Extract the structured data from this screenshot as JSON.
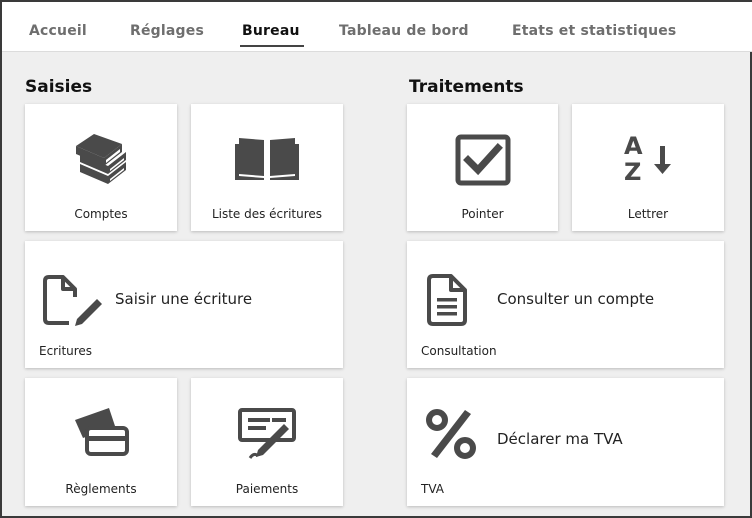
{
  "tabs": [
    {
      "label": "Accueil"
    },
    {
      "label": "Réglages"
    },
    {
      "label": "Bureau"
    },
    {
      "label": "Tableau de bord"
    },
    {
      "label": "Etats et statistiques"
    }
  ],
  "active_tab": "Bureau",
  "sections": {
    "saisies": {
      "title": "Saisies",
      "comptes": {
        "label": "Comptes",
        "icon": "books-icon"
      },
      "liste_ecritures": {
        "label": "Liste des écritures",
        "icon": "open-book-icon"
      },
      "ecritures": {
        "action": "Saisir une écriture",
        "label": "Ecritures",
        "icon": "document-edit-icon"
      },
      "reglements": {
        "label": "Règlements",
        "icon": "credit-cards-icon"
      },
      "paiements": {
        "label": "Paiements",
        "icon": "check-sign-icon"
      }
    },
    "traitements": {
      "title": "Traitements",
      "pointer": {
        "label": "Pointer",
        "icon": "checkbox-icon"
      },
      "lettrer": {
        "label": "Lettrer",
        "icon": "sort-az-icon"
      },
      "consultation": {
        "action": "Consulter un compte",
        "label": "Consultation",
        "icon": "document-lines-icon"
      },
      "tva": {
        "action": "Déclarer ma TVA",
        "label": "TVA",
        "icon": "percent-icon"
      }
    }
  },
  "colors": {
    "icon": "#4a4a4a",
    "background": "#efefef",
    "tile": "#ffffff"
  }
}
